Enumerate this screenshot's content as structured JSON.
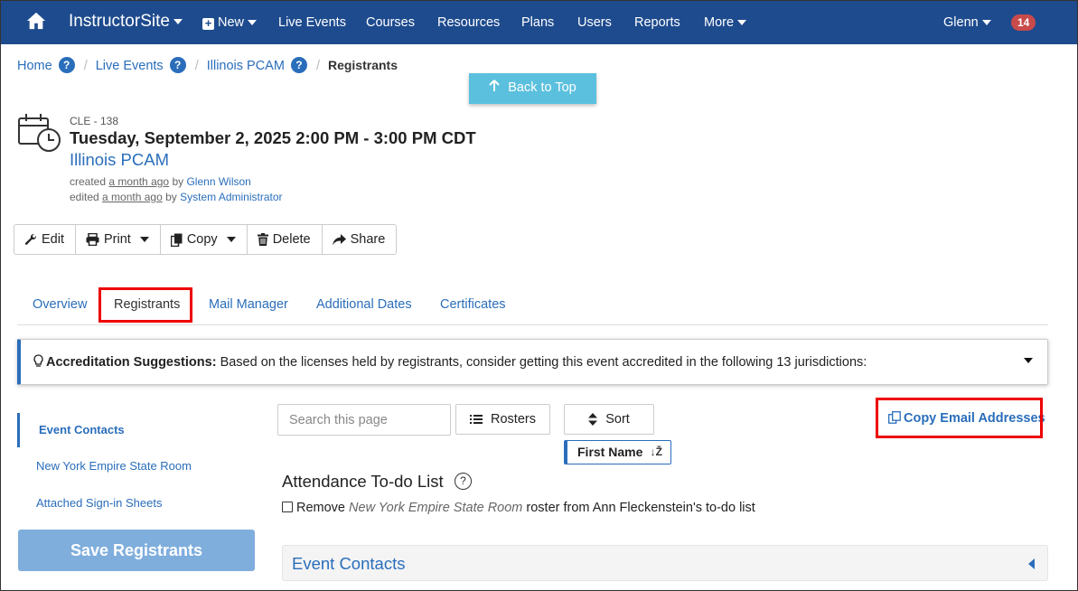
{
  "nav": {
    "brand": "InstructorSite",
    "new_label": "New",
    "items": [
      "Live Events",
      "Courses",
      "Resources",
      "Plans",
      "Users",
      "Reports"
    ],
    "more_label": "More",
    "user_label": "Glenn",
    "badge_count": "14"
  },
  "breadcrumb": {
    "items": [
      "Home",
      "Live Events",
      "Illinois PCAM"
    ],
    "help_glyph": "?",
    "separator": "/",
    "current": "Registrants"
  },
  "back_to_top": "Back to Top",
  "event": {
    "code": "CLE - 138",
    "date": "Tuesday, September 2, 2025 2:00 PM - 3:00 PM CDT",
    "title": "Illinois PCAM",
    "created_prefix": "created",
    "created_when": "a month ago",
    "created_by_word": "by",
    "created_by": "Glenn Wilson",
    "edited_prefix": "edited",
    "edited_when": "a month ago",
    "edited_by_word": "by",
    "edited_by": "System Administrator"
  },
  "toolbar": {
    "edit": "Edit",
    "print": "Print",
    "copy": "Copy",
    "delete": "Delete",
    "share": "Share"
  },
  "tabs": [
    "Overview",
    "Registrants",
    "Mail Manager",
    "Additional Dates",
    "Certificates"
  ],
  "accreditation": {
    "heading": "Accreditation Suggestions:",
    "text": "Based on the licenses held by registrants, consider getting this event accredited in the following 13 jurisdictions:"
  },
  "sidenav": {
    "items": [
      "Event Contacts",
      "New York Empire State Room",
      "Attached Sign-in Sheets"
    ],
    "save_button": "Save Registrants"
  },
  "controls": {
    "search_placeholder": "Search this page",
    "rosters": "Rosters",
    "sort": "Sort",
    "sort_field": "First Name",
    "copy_emails": "Copy Email Addresses"
  },
  "attendance": {
    "title": "Attendance To-do List",
    "help_glyph": "?",
    "remove_prefix": "Remove",
    "room": "New York Empire State Room",
    "remove_suffix": "roster from Ann Fleckenstein's to-do list"
  },
  "contacts_panel": "Event Contacts",
  "colors": {
    "nav_bg": "#1e4b8e",
    "link": "#2a6ebb",
    "highlight_box": "#e00000",
    "back_to_top_bg": "#5bc0de",
    "badge_bg": "#c84a4a"
  }
}
